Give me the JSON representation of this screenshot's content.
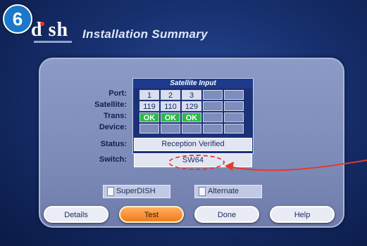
{
  "step_number": "6",
  "logo_text": "d sh",
  "title": "Installation Summary",
  "satellite_input": {
    "header": "Satellite Input",
    "labels": [
      "Port:",
      "Satellite:",
      "Trans:",
      "Device:",
      "Status:",
      "Switch:"
    ],
    "ports": [
      "1",
      "2",
      "3",
      "",
      ""
    ],
    "satellites": [
      "119",
      "110",
      "129",
      "",
      ""
    ],
    "trans": [
      "OK",
      "OK",
      "OK",
      "",
      ""
    ]
  },
  "status": "Reception Verified",
  "switch": "SW64",
  "toggles": {
    "superdish": "SuperDISH",
    "alternate": "Alternate"
  },
  "buttons": {
    "details": "Details",
    "test": "Test",
    "done": "Done",
    "help": "Help"
  },
  "colors": {
    "ok": "#2eb84a",
    "highlight": "#e53a2a",
    "active_button": "#f07b1a"
  }
}
